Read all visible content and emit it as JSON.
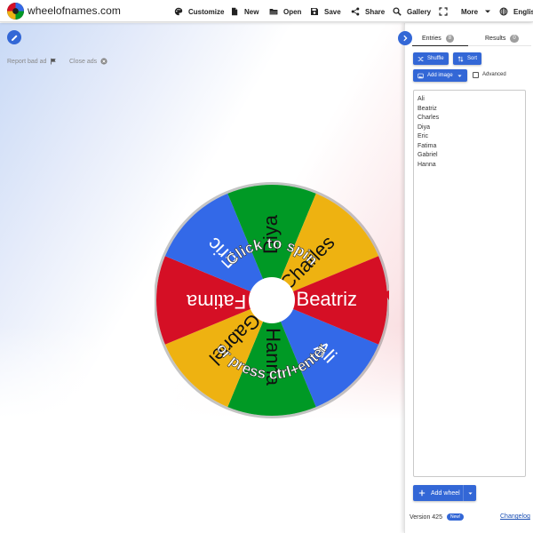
{
  "app": {
    "name": "wheelofnames.com"
  },
  "nav": [
    {
      "label": "Customize",
      "icon": "palette-icon"
    },
    {
      "label": "New",
      "icon": "new-file-icon"
    },
    {
      "label": "Open",
      "icon": "folder-open-icon"
    },
    {
      "label": "Save",
      "icon": "save-icon"
    },
    {
      "label": "Share",
      "icon": "share-icon"
    },
    {
      "label": "Gallery",
      "icon": "search-icon"
    },
    {
      "label": "",
      "icon": "fullscreen-icon"
    },
    {
      "label": "More",
      "icon": "chevron-down-icon"
    },
    {
      "label": "English",
      "icon": "globe-icon"
    }
  ],
  "ads": {
    "report_label": "Report bad ad",
    "close_label": "Close ads"
  },
  "wheel": {
    "slices": [
      {
        "name": "Ali",
        "color": "#3369e8"
      },
      {
        "name": "Hanna",
        "color": "#009925"
      },
      {
        "name": "Gabriel",
        "color": "#eeb211"
      },
      {
        "name": "Fatima",
        "color": "#d50f25"
      },
      {
        "name": "Eric",
        "color": "#3369e8"
      },
      {
        "name": "Diya",
        "color": "#009925"
      },
      {
        "name": "Charles",
        "color": "#eeb211"
      },
      {
        "name": "Beatriz",
        "color": "#d50f25"
      }
    ],
    "prompt_top": "Click to spin",
    "prompt_bottom": "or press ctrl+enter",
    "pointer_color": "#d50f25"
  },
  "panel": {
    "tabs": [
      {
        "label": "Entries",
        "count": "8"
      },
      {
        "label": "Results",
        "count": "0"
      }
    ],
    "shuffle_label": "Shuffle",
    "sort_label": "Sort",
    "add_image_label": "Add image",
    "advanced_label": "Advanced",
    "entries": [
      "Ali",
      "Beatriz",
      "Charles",
      "Diya",
      "Eric",
      "Fatima",
      "Gabriel",
      "Hanna"
    ],
    "add_wheel_label": "Add wheel",
    "version": "Version 425",
    "new_badge": "New!",
    "changelog": "Changelog"
  },
  "colors": {
    "accent": "#3367d6",
    "blue": "#3369e8",
    "green": "#009925",
    "yellow": "#eeb211",
    "red": "#d50f25"
  }
}
